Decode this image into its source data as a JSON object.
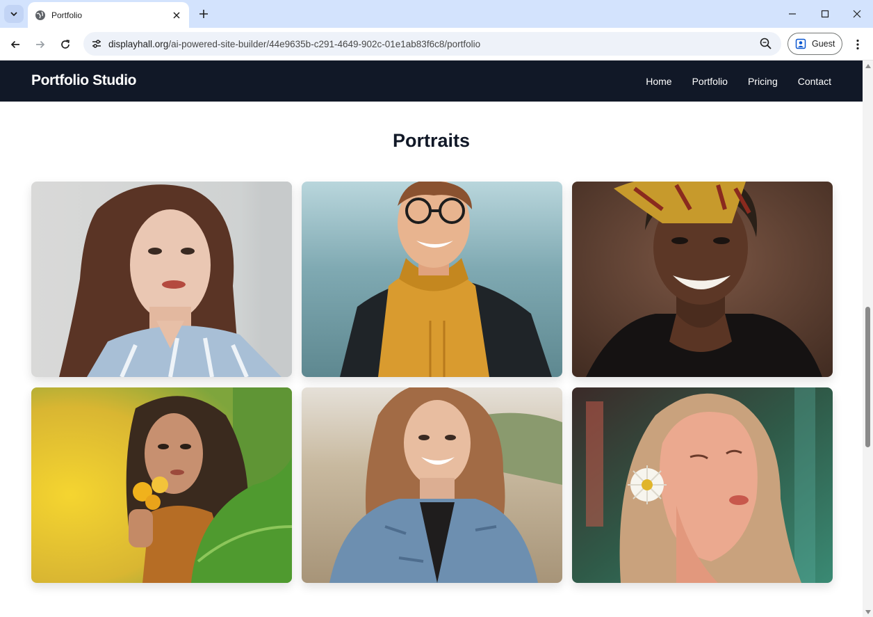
{
  "browser": {
    "tab": {
      "title": "Portfolio"
    },
    "address": {
      "host": "displayhall.org",
      "path": "/ai-powered-site-builder/44e9635b-c291-4649-902c-01e1ab83f6c8/portfolio"
    },
    "profile_label": "Guest"
  },
  "site": {
    "brand": "Portfolio Studio",
    "nav": [
      {
        "label": "Home"
      },
      {
        "label": "Portfolio"
      },
      {
        "label": "Pricing"
      },
      {
        "label": "Contact"
      }
    ],
    "section_title": "Portraits"
  },
  "gallery": [
    {
      "subject": "woman in striped shirt",
      "palette": [
        "#dcdcdb",
        "#bfc3c4",
        "#e9c3ae",
        "#5b3425",
        "#9db5cf"
      ]
    },
    {
      "subject": "smiling man in yellow hoodie",
      "palette": [
        "#8fb9c2",
        "#6d99a3",
        "#e3ae82",
        "#d99b2f",
        "#1d2226"
      ]
    },
    {
      "subject": "smiling woman with headwrap",
      "palette": [
        "#6b4a3a",
        "#4c3428",
        "#5a3524",
        "#d3a43a",
        "#1a1513"
      ]
    },
    {
      "subject": "woman with yellow flowers",
      "palette": [
        "#e8c928",
        "#6ea33a",
        "#c08963",
        "#3a2a1e",
        "#b66d25"
      ]
    },
    {
      "subject": "laughing woman in denim jacket",
      "palette": [
        "#d9d2c4",
        "#b6a58c",
        "#e4b89b",
        "#a26b45",
        "#6d8fb0"
      ]
    },
    {
      "subject": "woman with daisy in hair",
      "palette": [
        "#2b4a3a",
        "#3f7d6b",
        "#e9a58a",
        "#c98a6c",
        "#f4f1ea"
      ]
    }
  ]
}
